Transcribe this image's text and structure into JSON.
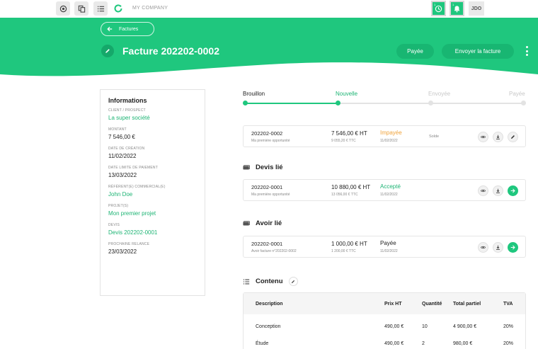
{
  "topbar": {
    "company": "MY COMPANY",
    "user_initials": "JDO",
    "notif_badge_1": "1",
    "notif_badge_2": "1",
    "icons": [
      "target-icon",
      "copy-icon",
      "list-icon",
      "refresh-logo-icon",
      "clock-icon",
      "bell-icon"
    ]
  },
  "header": {
    "back_label": "Factures",
    "title": "Facture 202202-0002",
    "status_button": "Payée",
    "send_button": "Envoyer la facture",
    "accent_color": "#1fc77e"
  },
  "info": {
    "title": "Informations",
    "fields": [
      {
        "label": "CLIENT / PROSPECT",
        "value": "La super société",
        "link": true
      },
      {
        "label": "MONTANT",
        "value": "7 546,00 €",
        "link": false
      },
      {
        "label": "DATE DE CRÉATION",
        "value": "11/02/2022",
        "link": false
      },
      {
        "label": "DATE LIMITE DE PAIEMENT",
        "value": "13/03/2022",
        "link": false
      },
      {
        "label": "RÉFÉRENT(E) COMMERCIAL(E)",
        "value": "John Doe",
        "link": true
      },
      {
        "label": "PROJET(S)",
        "value": "Mon premier projet",
        "link": true
      },
      {
        "label": "DEVIS",
        "value": "Devis 202202-0001",
        "link": true
      },
      {
        "label": "PROCHAINE RELANCE",
        "value": "23/03/2022",
        "link": false
      }
    ]
  },
  "steps": [
    {
      "label": "Brouillon",
      "state": "done"
    },
    {
      "label": "Nouvelle",
      "state": "current"
    },
    {
      "label": "Envoyée",
      "state": "todo"
    },
    {
      "label": "Payée",
      "state": "todo"
    }
  ],
  "invoice_row": {
    "number": "202202-0002",
    "subtitle": "Ma première opportunité",
    "amount_ht": "7 546,00 € HT",
    "amount_ttc": "9 055,20 € TTC",
    "status": "Impayée",
    "status_color": "#f0a33b",
    "date": "11/02/2022",
    "extra": "Solde"
  },
  "devis": {
    "title": "Devis lié",
    "number": "202202-0001",
    "subtitle": "Ma première opportunité",
    "amount_ht": "10 880,00 € HT",
    "amount_ttc": "13 056,00 € TTC",
    "status": "Accepté",
    "status_color": "#1db474",
    "date": "11/02/2022"
  },
  "avoir": {
    "title": "Avoir lié",
    "number": "202202-0001",
    "subtitle": "Avoir facture n°202202-0002",
    "amount_ht": "1 000,00 € HT",
    "amount_ttc": "1 200,00 € TTC",
    "status": "Payée",
    "status_color": "#222222",
    "date": "11/02/2022"
  },
  "contenu": {
    "title": "Contenu",
    "columns": [
      "Description",
      "Prix HT",
      "Quantité",
      "Total partiel",
      "TVA"
    ],
    "rows": [
      {
        "description": "Conception",
        "prix": "490,00 €",
        "quantite": "10",
        "total": "4 900,00 €",
        "tva": "20%"
      },
      {
        "description": "Étude",
        "prix": "490,00 €",
        "quantite": "2",
        "total": "980,00 €",
        "tva": "20%"
      }
    ]
  }
}
